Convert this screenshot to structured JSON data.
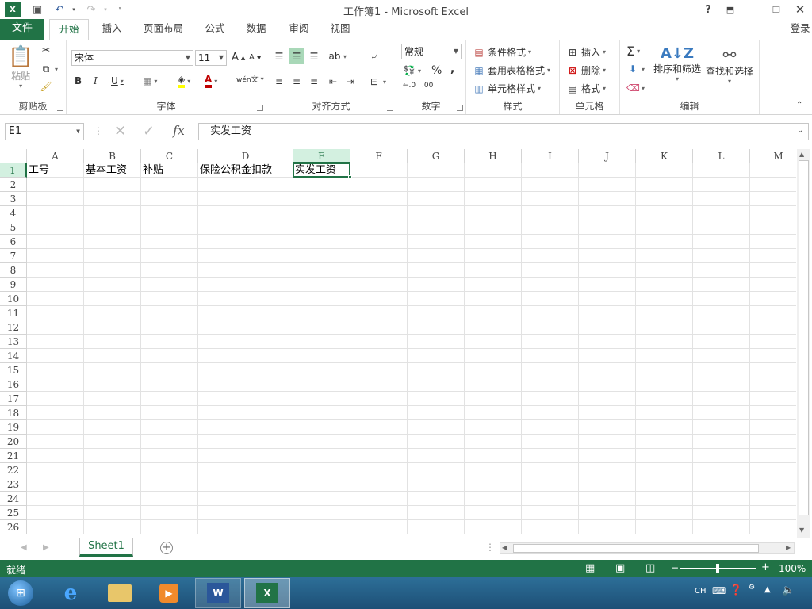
{
  "window": {
    "title": "工作簿1 - Microsoft Excel",
    "login": "登录"
  },
  "ribbon_tabs": [
    "文件",
    "开始",
    "插入",
    "页面布局",
    "公式",
    "数据",
    "审阅",
    "视图"
  ],
  "ribbon": {
    "clipboard": {
      "label": "剪贴板",
      "paste": "粘贴"
    },
    "font": {
      "label": "字体",
      "name": "宋体",
      "size": "11"
    },
    "alignment": {
      "label": "对齐方式"
    },
    "number": {
      "label": "数字",
      "format": "常规"
    },
    "styles": {
      "label": "样式",
      "conditional": "条件格式",
      "table": "套用表格格式",
      "cell_styles": "单元格样式"
    },
    "cells": {
      "label": "单元格",
      "insert": "插入",
      "delete": "删除",
      "format": "格式"
    },
    "editing": {
      "label": "编辑",
      "sort": "排序和筛选",
      "find": "查找和选择"
    }
  },
  "formula_bar": {
    "name_box": "E1",
    "fx": "fx",
    "content": "实发工资"
  },
  "columns": [
    "A",
    "B",
    "C",
    "D",
    "E",
    "F",
    "G",
    "H",
    "I",
    "J",
    "K",
    "L",
    "M"
  ],
  "rows": [
    "1",
    "2",
    "3",
    "4",
    "5",
    "6",
    "7",
    "8",
    "9",
    "10",
    "11",
    "12",
    "13",
    "14",
    "15",
    "16",
    "17",
    "18",
    "19",
    "20",
    "21",
    "22",
    "23",
    "24",
    "25",
    "26"
  ],
  "cells": {
    "A1": "工号",
    "B1": "基本工资",
    "C1": "补贴",
    "D1": "保险公积金扣款",
    "E1": "实发工资"
  },
  "selected_cell": "E1",
  "sheets": [
    "Sheet1"
  ],
  "status": {
    "ready": "就绪",
    "zoom": "100%"
  },
  "taskbar": {
    "lang": "CH"
  },
  "colors": {
    "accent": "#217346",
    "taskbar": "#1d4f76"
  }
}
